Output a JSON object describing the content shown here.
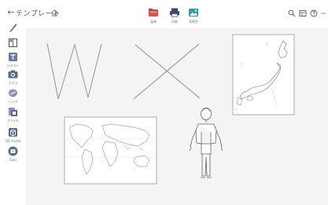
{
  "header": {
    "back_icon": "arrow-left-icon",
    "title": "テンプレート",
    "home_icon": "home-icon"
  },
  "toolbar": {
    "items": [
      {
        "label": "画像",
        "icon": "folder-icon",
        "color": "#d9534f"
      },
      {
        "label": "印刷",
        "icon": "printer-icon",
        "color": "#3d4a66"
      },
      {
        "label": "背景色",
        "icon": "image-icon",
        "color": "#2aa198"
      }
    ]
  },
  "right_controls": {
    "icons": [
      "zoom-icon",
      "view-icon",
      "help-icon",
      "more-icon"
    ]
  },
  "tools": [
    {
      "label": "",
      "icon": "pen-icon"
    },
    {
      "label": "",
      "icon": "layout-icon"
    },
    {
      "label": "テキスト",
      "icon": "text-icon"
    },
    {
      "label": "カメラ",
      "icon": "camera-icon"
    },
    {
      "label": "リンク",
      "icon": "link-icon"
    },
    {
      "label": "ファイル",
      "icon": "file-icon"
    },
    {
      "label": "3D model",
      "icon": "3d-model-icon"
    },
    {
      "label": "Tools",
      "icon": "tools-icon"
    }
  ]
}
